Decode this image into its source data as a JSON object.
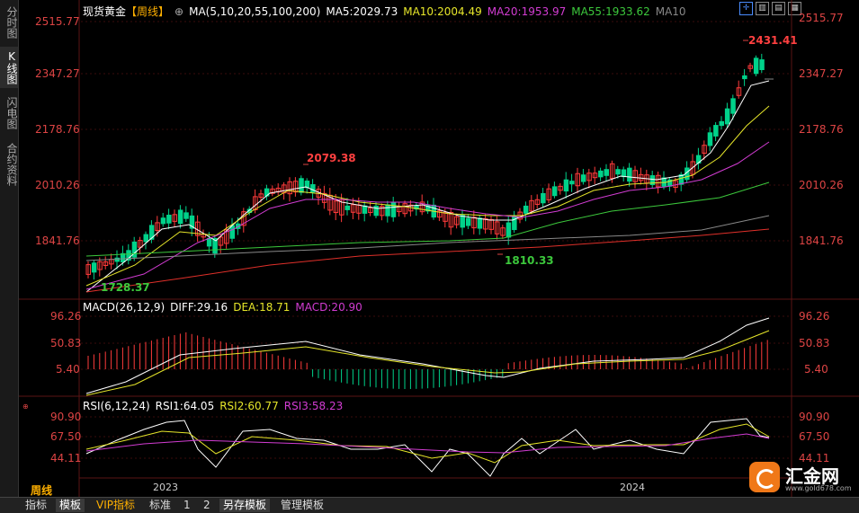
{
  "sidebar": {
    "tabs": [
      "分时图",
      "K线图",
      "闪电图",
      "合约资料"
    ],
    "active": 1
  },
  "header": {
    "title": "现货黄金",
    "period_tag": "【周线】",
    "ma_label": "MA(5,10,20,55,100,200)",
    "ma5": "MA5:2029.73",
    "ma10": "MA10:2004.49",
    "ma20": "MA20:1953.97",
    "ma55": "MA55:1933.62",
    "ma100": "MA10"
  },
  "price_axis": {
    "ticks": [
      "2515.77",
      "2347.27",
      "2178.76",
      "2010.26",
      "1841.76"
    ]
  },
  "annotations": {
    "high": "2431.41",
    "mid_high": "2079.38",
    "mid_low": "1810.33",
    "low": "1728.37"
  },
  "macd": {
    "title": "MACD(26,12,9)",
    "diff": "DIFF:29.16",
    "dea": "DEA:18.71",
    "macd": "MACD:20.90",
    "ticks": [
      "96.26",
      "50.83",
      "5.40"
    ]
  },
  "rsi": {
    "title": "RSI(6,12,24)",
    "rsi1": "RSI1:64.05",
    "rsi2": "RSI2:60.77",
    "rsi3": "RSI3:58.23",
    "ticks": [
      "90.90",
      "67.50",
      "44.11"
    ]
  },
  "x_axis": {
    "labels": [
      "2023",
      "2024"
    ]
  },
  "period_label": "周线",
  "bottom_tabs": [
    "指标",
    "模板",
    "VIP指标",
    "标准",
    "1",
    "2",
    "另存模板",
    "管理模板"
  ],
  "logo": {
    "name": "汇金网",
    "url": "www.gold678.com"
  },
  "colors": {
    "up": "#ff3b3b",
    "down": "#00d28a",
    "ma5": "#ffffff",
    "ma10": "#e6e62a",
    "ma20": "#d23cd2",
    "ma55": "#3cc83c",
    "ma100": "#888888",
    "ma200": "#e0302a"
  },
  "chart_data": {
    "type": "line",
    "title": "现货黄金 周线",
    "series": [
      {
        "name": "MA5",
        "values": []
      },
      {
        "name": "MA10",
        "values": []
      }
    ],
    "ylim": [
      1728.37,
      2515.77
    ]
  }
}
